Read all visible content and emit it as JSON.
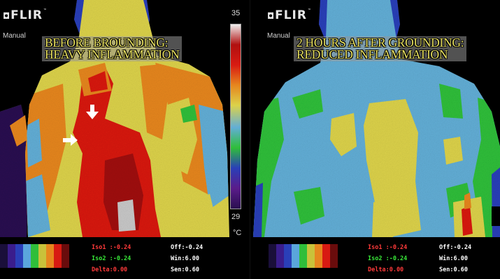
{
  "left": {
    "logo": "FLIR",
    "logo_mark": "™",
    "mode": "Manual",
    "caption_line1": "Before Brounding:",
    "caption_line2": "Heavy Inflammation",
    "scale_max": "35",
    "scale_min": "29",
    "unit": "°C",
    "iso1": "Iso1 :-0.24",
    "iso2": "Iso2 :-0.24",
    "delta": "Delta:0.00",
    "off": "Off:-0.24",
    "win": "Win:6.00",
    "sen": "Sen:0.60"
  },
  "right": {
    "logo": "FLIR",
    "logo_mark": "™",
    "mode": "Manual",
    "caption_line1": "2 Hours After Grounding:",
    "caption_line2": "Reduced Inflammation",
    "iso1": "Iso1 :-0.24",
    "iso2": "Iso2 :-0.24",
    "delta": "Delta:0.00",
    "off": "Off:-0.24",
    "win": "Win:6.00",
    "sen": "Sen:0.60"
  },
  "colors": {
    "red": "#d81a12",
    "orange": "#e6861e",
    "yellow": "#dcd24a",
    "lightblue": "#62aed6",
    "green": "#2fbe3a",
    "blue": "#2a3fb8",
    "purple": "#5a1c8a",
    "caption_text": "#e8e060",
    "iso1_color": "#ff3a3a",
    "iso2_color": "#38e838",
    "delta_color": "#ff3a3a"
  },
  "palette": [
    "#1a0f3a",
    "#3a1d8c",
    "#2a3fb8",
    "#5aa6dc",
    "#2fbe3a",
    "#c9c23a",
    "#e6861e",
    "#d81a12",
    "#6a0c0c"
  ],
  "scale_stops": [
    "#f0f0f0",
    "#b01010",
    "#d81a12",
    "#e6861e",
    "#dcd24a",
    "#62aed6",
    "#2fbe3a",
    "#2a3fb8",
    "#5a1c8a",
    "#2a0f50"
  ]
}
